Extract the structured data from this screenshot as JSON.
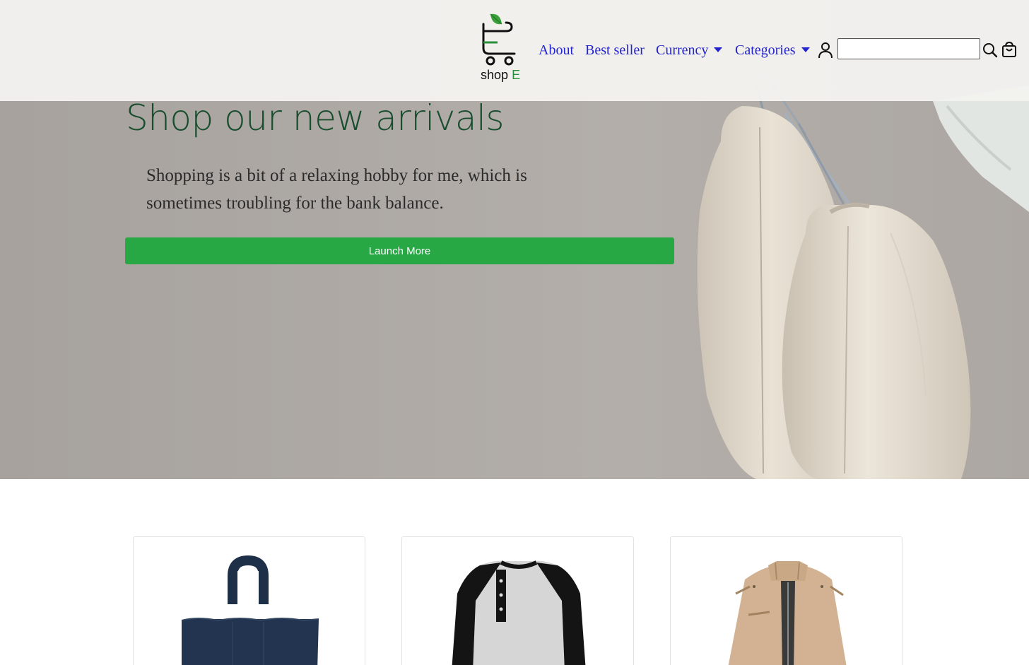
{
  "brand": {
    "name_part1": "shop",
    "name_part2": "E"
  },
  "nav": {
    "about": "About",
    "best_seller": "Best seller",
    "currency": "Currency",
    "categories": "Categories"
  },
  "search": {
    "value": "",
    "placeholder": ""
  },
  "icons": {
    "user": "user-icon",
    "search": "search-icon",
    "cart": "shopping-bag-icon"
  },
  "hero": {
    "title": "Shop our new arrivals",
    "subtitle": "Shopping is a bit of a relaxing hobby for me, which is sometimes troubling for the bank balance.",
    "button_label": "Launch More"
  },
  "products": [
    {
      "image": "navy-tote-bag"
    },
    {
      "image": "raglan-henley-shirt"
    },
    {
      "image": "khaki-jacket"
    }
  ],
  "colors": {
    "accent": "#28a745",
    "nav_link": "#2323cf",
    "hero_title": "#184d2d"
  }
}
